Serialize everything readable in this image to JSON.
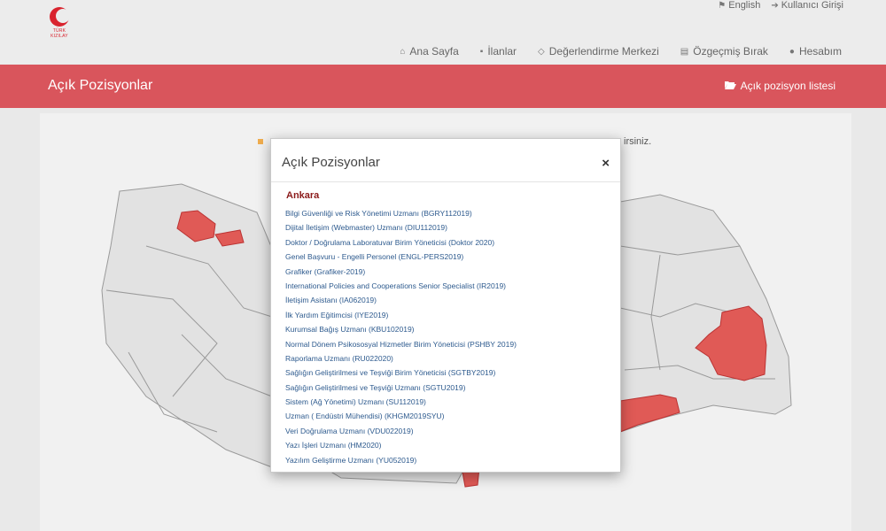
{
  "header": {
    "logo_text": "TÜRK KIZILAY",
    "lang_label": "English",
    "login_label": "Kullanıcı Girişi"
  },
  "nav": {
    "home": "Ana Sayfa",
    "listings": "İlanlar",
    "assessment": "Değerlendirme Merkezi",
    "cv": "Özgeçmiş Bırak",
    "account": "Hesabım"
  },
  "banner": {
    "title": "Açık Pozisyonlar",
    "list_link": "Açık pozisyon listesi"
  },
  "hint": {
    "text": "irsiniz."
  },
  "modal": {
    "title": "Açık Pozisyonlar",
    "close": "×",
    "city": "Ankara",
    "positions": [
      "Bilgi Güvenliği ve Risk Yönetimi Uzmanı (BGRY112019)",
      "Dijital İletişim (Webmaster) Uzmanı (DIU112019)",
      "Doktor / Doğrulama Laboratuvar Birim Yöneticisi (Doktor 2020)",
      "Genel Başvuru - Engelli Personel (ENGL-PERS2019)",
      "Grafiker (Grafiker-2019)",
      "International Policies and Cooperations Senior Specialist (IR2019)",
      "İletişim Asistanı (IA062019)",
      "İlk Yardım Eğitimcisi (IYE2019)",
      "Kurumsal Bağış Uzmanı (KBU102019)",
      "Normal Dönem Psikososyal Hizmetler Birim Yöneticisi (PSHBY 2019)",
      "Raporlama Uzmanı (RU022020)",
      "Sağlığın Geliştirilmesi ve Teşviği Birim Yöneticisi (SGTBY2019)",
      "Sağlığın Geliştirilmesi ve Teşviği Uzmanı (SGTU2019)",
      "Sistem (Ağ Yönetimi) Uzmanı (SU112019)",
      "Uzman ( Endüstri Mühendisi) (KHGM2019SYU)",
      "Veri Doğrulama Uzmanı (VDU022019)",
      "Yazı İşleri Uzmanı (HM2020)",
      "Yazılım Geliştirme Uzmanı (YU052019)"
    ]
  },
  "colors": {
    "brand_red": "#d9555c",
    "highlight_province": "#e05a56",
    "province_fill": "#e2e2e2",
    "link_blue": "#2d5a8e"
  }
}
